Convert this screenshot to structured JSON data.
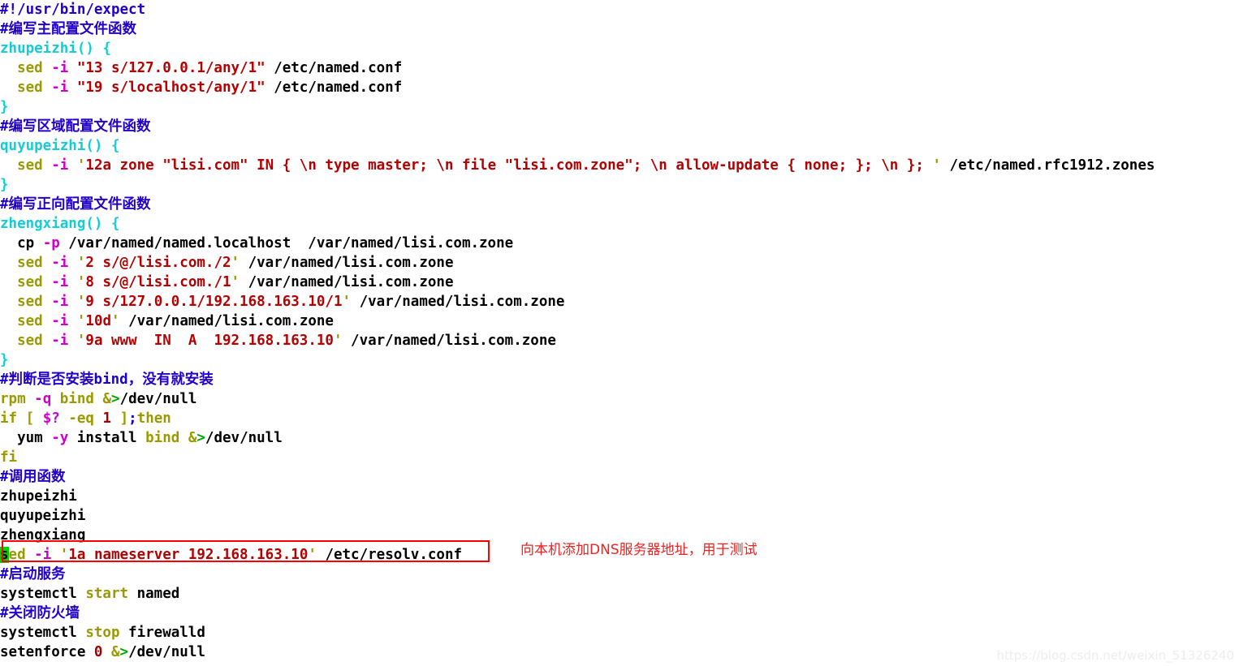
{
  "document": {
    "type": "shell-script-screenshot",
    "shebang": "#!/usr/bin/expect",
    "watermark": "https://blog.csdn.net/weixin_51326240"
  },
  "annotation": {
    "text": "向本机添加DNS服务器地址，用于测试",
    "color": "#ee2222",
    "box_color": "#ff0000"
  },
  "colors": {
    "comment": "#2200cc",
    "function": "#12cdd4",
    "command": "#9a9a00",
    "option": "#cc00cc",
    "string": "#b40000",
    "plain": "#000000",
    "redirect": "#00a400",
    "cursor": "#00d000",
    "background": "#ffffff"
  },
  "lines": [
    {
      "n": 1,
      "text": "#!/usr/bin/expect"
    },
    {
      "n": 2,
      "text": "#编写主配置文件函数"
    },
    {
      "n": 3,
      "text": "zhupeizhi() {"
    },
    {
      "n": 4,
      "text": "  sed -i \"13 s/127.0.0.1/any/1\" /etc/named.conf"
    },
    {
      "n": 5,
      "text": "  sed -i \"19 s/localhost/any/1\" /etc/named.conf"
    },
    {
      "n": 6,
      "text": "}"
    },
    {
      "n": 7,
      "text": "#编写区域配置文件函数"
    },
    {
      "n": 8,
      "text": "quyupeizhi() {"
    },
    {
      "n": 9,
      "text": "  sed -i '12a zone \"lisi.com\" IN { \\n type master; \\n file \"lisi.com.zone\"; \\n allow-update { none; }; \\n }; ' /etc/named.rfc1912.zones"
    },
    {
      "n": 10,
      "text": "}"
    },
    {
      "n": 11,
      "text": "#编写正向配置文件函数"
    },
    {
      "n": 12,
      "text": "zhengxiang() {"
    },
    {
      "n": 13,
      "text": "  cp -p /var/named/named.localhost  /var/named/lisi.com.zone"
    },
    {
      "n": 14,
      "text": "  sed -i '2 s/@/lisi.com./2' /var/named/lisi.com.zone"
    },
    {
      "n": 15,
      "text": "  sed -i '8 s/@/lisi.com./1' /var/named/lisi.com.zone"
    },
    {
      "n": 16,
      "text": "  sed -i '9 s/127.0.0.1/192.168.163.10/1' /var/named/lisi.com.zone"
    },
    {
      "n": 17,
      "text": "  sed -i '10d' /var/named/lisi.com.zone"
    },
    {
      "n": 18,
      "text": "  sed -i '9a www  IN  A  192.168.163.10' /var/named/lisi.com.zone"
    },
    {
      "n": 19,
      "text": "}"
    },
    {
      "n": 20,
      "text": "#判断是否安装bind，没有就安装"
    },
    {
      "n": 21,
      "text": "rpm -q bind &>/dev/null"
    },
    {
      "n": 22,
      "text": "if [ $? -eq 1 ];then"
    },
    {
      "n": 23,
      "text": "  yum -y install bind &>/dev/null"
    },
    {
      "n": 24,
      "text": "fi"
    },
    {
      "n": 25,
      "text": "#调用函数"
    },
    {
      "n": 26,
      "text": "zhupeizhi"
    },
    {
      "n": 27,
      "text": "quyupeizhi"
    },
    {
      "n": 28,
      "text": "zhengxiang"
    },
    {
      "n": 29,
      "text": "sed -i '1a nameserver 192.168.163.10' /etc/resolv.conf"
    },
    {
      "n": 30,
      "text": "#启动服务"
    },
    {
      "n": 31,
      "text": "systemctl start named"
    },
    {
      "n": 32,
      "text": "#关闭防火墙"
    },
    {
      "n": 33,
      "text": "systemctl stop firewalld"
    },
    {
      "n": 34,
      "text": "setenforce 0 &>/dev/null"
    }
  ],
  "tokens": {
    "l1": [
      [
        "t-comment",
        "#!/usr/bin/expect"
      ]
    ],
    "l2": [
      [
        "t-hash",
        "#"
      ],
      [
        "t-comment",
        "编写主配置文件函数"
      ]
    ],
    "l3": [
      [
        "t-func",
        "zhupeizhi() {"
      ]
    ],
    "l4": [
      [
        "t-plain",
        "  "
      ],
      [
        "t-cmd",
        "sed"
      ],
      [
        "t-plain",
        " "
      ],
      [
        "t-opt",
        "-i"
      ],
      [
        "t-plain",
        " "
      ],
      [
        "t-str",
        "\"13 s/127.0.0.1/any/1\""
      ],
      [
        "t-plain",
        " /etc/named.conf"
      ]
    ],
    "l5": [
      [
        "t-plain",
        "  "
      ],
      [
        "t-cmd",
        "sed"
      ],
      [
        "t-plain",
        " "
      ],
      [
        "t-opt",
        "-i"
      ],
      [
        "t-plain",
        " "
      ],
      [
        "t-str",
        "\"19 s/localhost/any/1\""
      ],
      [
        "t-plain",
        " /etc/named.conf"
      ]
    ],
    "l6": [
      [
        "t-brace",
        "}"
      ]
    ],
    "l7": [
      [
        "t-hash",
        "#"
      ],
      [
        "t-comment",
        "编写区域配置文件函数"
      ]
    ],
    "l8": [
      [
        "t-func",
        "quyupeizhi() {"
      ]
    ],
    "l9": [
      [
        "t-plain",
        "  "
      ],
      [
        "t-cmd",
        "sed"
      ],
      [
        "t-plain",
        " "
      ],
      [
        "t-opt",
        "-i"
      ],
      [
        "t-plain",
        " "
      ],
      [
        "t-quote",
        "'"
      ],
      [
        "t-str",
        "12a zone \"lisi.com\" IN { \\n type master; \\n file \"lisi.com.zone\"; \\n allow-update { none; }; \\n }; "
      ],
      [
        "t-quote",
        "'"
      ],
      [
        "t-plain",
        " /etc/named.rfc1912.zones"
      ]
    ],
    "l10": [
      [
        "t-brace",
        "}"
      ]
    ],
    "l11": [
      [
        "t-hash",
        "#"
      ],
      [
        "t-comment",
        "编写正向配置文件函数"
      ]
    ],
    "l12": [
      [
        "t-func",
        "zhengxiang() {"
      ]
    ],
    "l13": [
      [
        "t-plain",
        "  cp "
      ],
      [
        "t-opt",
        "-p"
      ],
      [
        "t-plain",
        " /var/named/named.localhost  /var/named/lisi.com.zone"
      ]
    ],
    "l14": [
      [
        "t-plain",
        "  "
      ],
      [
        "t-cmd",
        "sed"
      ],
      [
        "t-plain",
        " "
      ],
      [
        "t-opt",
        "-i"
      ],
      [
        "t-plain",
        " "
      ],
      [
        "t-quote",
        "'"
      ],
      [
        "t-str",
        "2 s/@/lisi.com./2"
      ],
      [
        "t-quote",
        "'"
      ],
      [
        "t-plain",
        " /var/named/lisi.com.zone"
      ]
    ],
    "l15": [
      [
        "t-plain",
        "  "
      ],
      [
        "t-cmd",
        "sed"
      ],
      [
        "t-plain",
        " "
      ],
      [
        "t-opt",
        "-i"
      ],
      [
        "t-plain",
        " "
      ],
      [
        "t-quote",
        "'"
      ],
      [
        "t-str",
        "8 s/@/lisi.com./1"
      ],
      [
        "t-quote",
        "'"
      ],
      [
        "t-plain",
        " /var/named/lisi.com.zone"
      ]
    ],
    "l16": [
      [
        "t-plain",
        "  "
      ],
      [
        "t-cmd",
        "sed"
      ],
      [
        "t-plain",
        " "
      ],
      [
        "t-opt",
        "-i"
      ],
      [
        "t-plain",
        " "
      ],
      [
        "t-quote",
        "'"
      ],
      [
        "t-str",
        "9 s/127.0.0.1/192.168.163.10/1"
      ],
      [
        "t-quote",
        "'"
      ],
      [
        "t-plain",
        " /var/named/lisi.com.zone"
      ]
    ],
    "l17": [
      [
        "t-plain",
        "  "
      ],
      [
        "t-cmd",
        "sed"
      ],
      [
        "t-plain",
        " "
      ],
      [
        "t-opt",
        "-i"
      ],
      [
        "t-plain",
        " "
      ],
      [
        "t-quote",
        "'"
      ],
      [
        "t-str",
        "10d"
      ],
      [
        "t-quote",
        "'"
      ],
      [
        "t-plain",
        " /var/named/lisi.com.zone"
      ]
    ],
    "l18": [
      [
        "t-plain",
        "  "
      ],
      [
        "t-cmd",
        "sed"
      ],
      [
        "t-plain",
        " "
      ],
      [
        "t-opt",
        "-i"
      ],
      [
        "t-plain",
        " "
      ],
      [
        "t-quote",
        "'"
      ],
      [
        "t-str",
        "9a www  IN  A  192.168.163.10"
      ],
      [
        "t-quote",
        "'"
      ],
      [
        "t-plain",
        " /var/named/lisi.com.zone"
      ]
    ],
    "l19": [
      [
        "t-brace",
        "}"
      ]
    ],
    "l20": [
      [
        "t-hash",
        "#"
      ],
      [
        "t-comment",
        "判断是否安装"
      ],
      [
        "t-hash",
        "bind"
      ],
      [
        "t-comment",
        "，没有就安装"
      ]
    ],
    "l21": [
      [
        "t-cmd",
        "rpm"
      ],
      [
        "t-plain",
        " "
      ],
      [
        "t-opt",
        "-q"
      ],
      [
        "t-plain",
        " "
      ],
      [
        "t-cmd",
        "bind"
      ],
      [
        "t-plain",
        " "
      ],
      [
        "t-cmd",
        "&"
      ],
      [
        "t-redir",
        ">"
      ],
      [
        "t-plain",
        "/dev/null"
      ]
    ],
    "l22": [
      [
        "t-kw",
        "if"
      ],
      [
        "t-plain",
        " "
      ],
      [
        "t-kw",
        "["
      ],
      [
        "t-plain",
        " "
      ],
      [
        "t-var",
        "$?"
      ],
      [
        "t-plain",
        " "
      ],
      [
        "t-kw",
        "-eq"
      ],
      [
        "t-plain",
        " "
      ],
      [
        "t-num",
        "1"
      ],
      [
        "t-plain",
        " "
      ],
      [
        "t-kw",
        "]"
      ],
      [
        "t-semi",
        ";"
      ],
      [
        "t-kw",
        "then"
      ]
    ],
    "l23": [
      [
        "t-plain",
        "  yum "
      ],
      [
        "t-opt",
        "-y"
      ],
      [
        "t-plain",
        " install "
      ],
      [
        "t-cmd",
        "bind"
      ],
      [
        "t-plain",
        " "
      ],
      [
        "t-cmd",
        "&"
      ],
      [
        "t-redir",
        ">"
      ],
      [
        "t-plain",
        "/dev/null"
      ]
    ],
    "l24": [
      [
        "t-kw",
        "fi"
      ]
    ],
    "l25": [
      [
        "t-hash",
        "#"
      ],
      [
        "t-comment",
        "调用函数"
      ]
    ],
    "l26": [
      [
        "t-plain",
        "zhupeizhi"
      ]
    ],
    "l27": [
      [
        "t-plain",
        "quyupeizhi"
      ]
    ],
    "l28": [
      [
        "t-plain",
        "zhengxiang"
      ]
    ],
    "l29": [
      [
        "cursor-block",
        "s"
      ],
      [
        "t-cmd",
        "ed"
      ],
      [
        "t-plain",
        " "
      ],
      [
        "t-opt",
        "-i"
      ],
      [
        "t-plain",
        " "
      ],
      [
        "t-quote",
        "'"
      ],
      [
        "t-str",
        "1a nameserver 192.168.163.10"
      ],
      [
        "t-quote",
        "'"
      ],
      [
        "t-plain",
        " /etc/resolv.conf"
      ]
    ],
    "l30": [
      [
        "t-hash",
        "#"
      ],
      [
        "t-comment",
        "启动服务"
      ]
    ],
    "l31": [
      [
        "t-plain",
        "systemctl "
      ],
      [
        "t-cmd",
        "start"
      ],
      [
        "t-plain",
        " named"
      ]
    ],
    "l32": [
      [
        "t-hash",
        "#"
      ],
      [
        "t-comment",
        "关闭防火墙"
      ]
    ],
    "l33": [
      [
        "t-plain",
        "systemctl "
      ],
      [
        "t-cmd",
        "stop"
      ],
      [
        "t-plain",
        " firewalld"
      ]
    ],
    "l34": [
      [
        "t-plain",
        "setenforce "
      ],
      [
        "t-num",
        "0"
      ],
      [
        "t-plain",
        " "
      ],
      [
        "t-cmd",
        "&"
      ],
      [
        "t-redir",
        ">"
      ],
      [
        "t-plain",
        "/dev/null"
      ]
    ]
  }
}
